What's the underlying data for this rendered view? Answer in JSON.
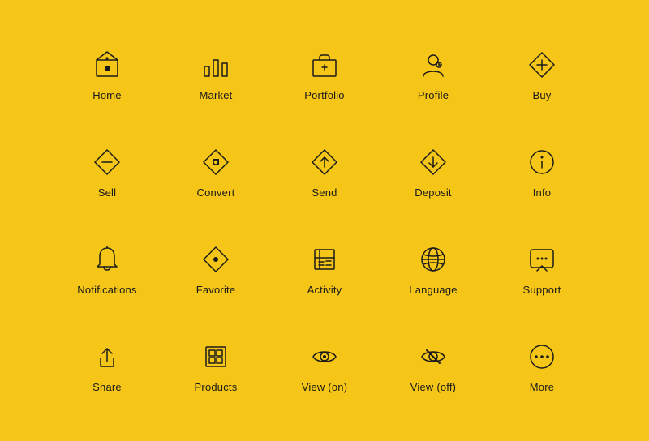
{
  "icons": [
    {
      "id": "home",
      "label": "Home"
    },
    {
      "id": "market",
      "label": "Market"
    },
    {
      "id": "portfolio",
      "label": "Portfolio"
    },
    {
      "id": "profile",
      "label": "Profile"
    },
    {
      "id": "buy",
      "label": "Buy"
    },
    {
      "id": "sell",
      "label": "Sell"
    },
    {
      "id": "convert",
      "label": "Convert"
    },
    {
      "id": "send",
      "label": "Send"
    },
    {
      "id": "deposit",
      "label": "Deposit"
    },
    {
      "id": "info",
      "label": "Info"
    },
    {
      "id": "notifications",
      "label": "Notifications"
    },
    {
      "id": "favorite",
      "label": "Favorite"
    },
    {
      "id": "activity",
      "label": "Activity"
    },
    {
      "id": "language",
      "label": "Language"
    },
    {
      "id": "support",
      "label": "Support"
    },
    {
      "id": "share",
      "label": "Share"
    },
    {
      "id": "products",
      "label": "Products"
    },
    {
      "id": "view-on",
      "label": "View (on)"
    },
    {
      "id": "view-off",
      "label": "View (off)"
    },
    {
      "id": "more",
      "label": "More"
    }
  ]
}
